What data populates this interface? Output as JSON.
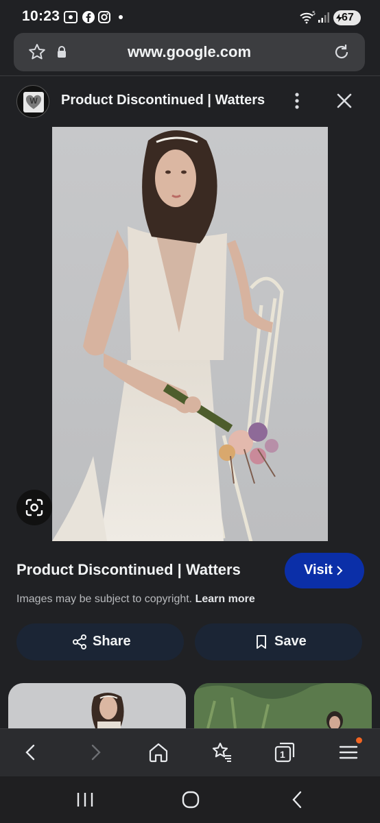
{
  "status_bar": {
    "time": "10:23",
    "icons": [
      "screenshot-icon",
      "facebook-icon",
      "instagram-icon",
      "notification-dot-icon",
      "wifi-5g-icon",
      "signal-icon"
    ],
    "battery": "67"
  },
  "browser": {
    "url": "www.google.com",
    "icons": [
      "star-icon",
      "lock-icon",
      "reload-icon"
    ]
  },
  "image_viewer": {
    "site_logo_letter": "W",
    "header_title": "Product Discontinued | Watters",
    "result_title": "Product Discontinued | Watters",
    "visit_label": "Visit",
    "copyright_text": "Images may be subject to copyright.",
    "learn_more": "Learn more",
    "share_label": "Share",
    "save_label": "Save"
  },
  "toolbar": {
    "tab_count": "1",
    "items": [
      "back-icon",
      "forward-icon",
      "home-icon",
      "bookmarks-icon",
      "tabs-icon",
      "menu-icon"
    ],
    "menu_badge_color": "#f26522"
  },
  "colors": {
    "background": "#202124",
    "visit_button": "#0b2fa8",
    "pill_button": "#1b2535"
  }
}
